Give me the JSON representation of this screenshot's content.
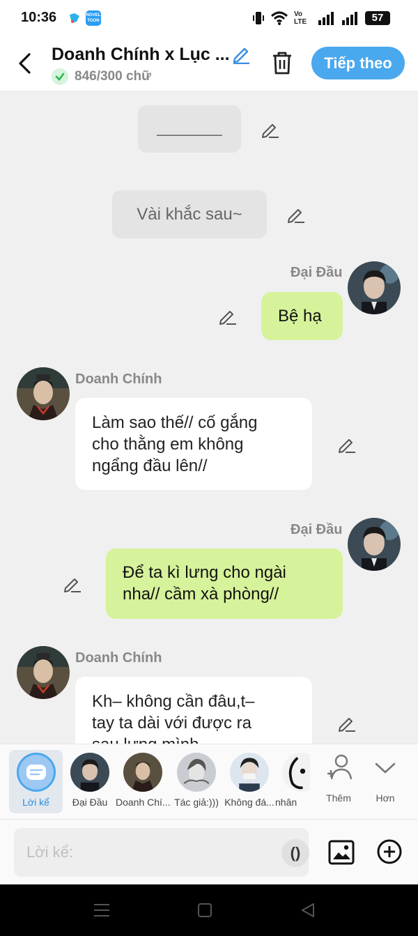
{
  "status": {
    "time": "10:36",
    "battery": "57",
    "network": "Vo LTE"
  },
  "header": {
    "title": "Doanh Chính x Lục ...",
    "word_count": "846/300 chữ",
    "next_label": "Tiếp theo"
  },
  "messages": [
    {
      "type": "narration",
      "text": "_______"
    },
    {
      "type": "narration",
      "text": "Vài khắc sau~"
    },
    {
      "type": "right",
      "speaker": "Đại Đầu",
      "lines": [
        "Bệ hạ"
      ]
    },
    {
      "type": "left",
      "speaker": "Doanh Chính",
      "lines": [
        "Làm sao thế// cố gắng",
        "cho thằng em không",
        "ngẩng đầu lên//"
      ]
    },
    {
      "type": "right",
      "speaker": "Đại Đầu",
      "lines": [
        "Để ta kì lưng cho ngài",
        "nha// cầm xà phòng//"
      ]
    },
    {
      "type": "left",
      "speaker": "Doanh Chính",
      "lines": [
        "Kh– không cần đâu,t–",
        "tay ta dài với được ra",
        "sau lưng mình"
      ]
    }
  ],
  "characters": {
    "narrator_label": "Lời kể",
    "items": [
      "Đại Đầu",
      "Doanh Chí...",
      "Tác giả:)))",
      "Không đá...",
      "nhân"
    ],
    "add_label": "Thêm",
    "more_label": "Hơn"
  },
  "input": {
    "placeholder": "Lời kể:",
    "paren": "()"
  },
  "colors": {
    "accent": "#4aa8ee",
    "bubble_right": "#d6f29a",
    "narration_bg": "#e4e4e4",
    "background": "#f0f0f0"
  }
}
